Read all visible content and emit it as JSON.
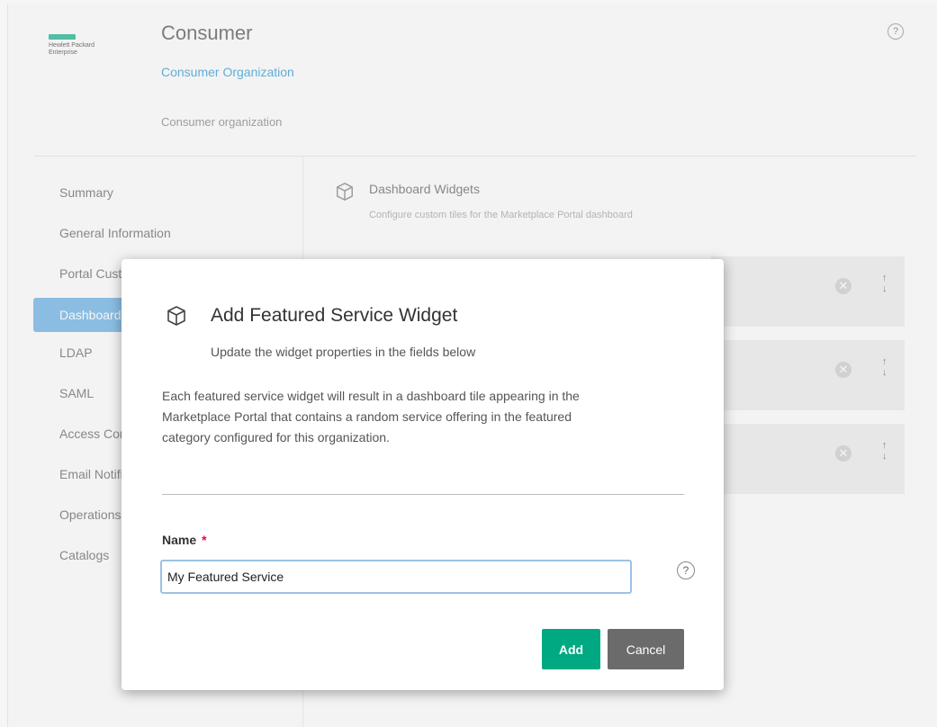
{
  "header": {
    "logo_lines": "Hewlett Packard\nEnterprise",
    "title": "Consumer",
    "org_link": "Consumer Organization",
    "subtitle": "Consumer organization",
    "help_symbol": "?"
  },
  "sidebar": {
    "items": [
      {
        "label": "Summary"
      },
      {
        "label": "General Information"
      },
      {
        "label": "Portal Customization"
      },
      {
        "label": "Dashboard Widgets",
        "active": true
      },
      {
        "label": "LDAP"
      },
      {
        "label": "SAML"
      },
      {
        "label": "Access Control"
      },
      {
        "label": "Email Notifications"
      },
      {
        "label": "Operations"
      },
      {
        "label": "Catalogs"
      }
    ]
  },
  "section": {
    "icon": "cube-icon",
    "title": "Dashboard Widgets",
    "subtitle": "Configure custom tiles for the Marketplace Portal dashboard",
    "rows": [
      {
        "remove_icon": "✕",
        "arrows": "↑\n↓"
      },
      {
        "remove_icon": "✕",
        "arrows": "↑\n↓"
      },
      {
        "remove_icon": "✕",
        "arrows": "↑\n↓"
      }
    ]
  },
  "modal": {
    "icon": "cube-icon",
    "title": "Add Featured Service Widget",
    "subtitle": "Update the widget properties in the fields below",
    "description": "Each featured service widget will result in a dashboard tile appearing in the Marketplace Portal that contains a random service offering in the featured category configured for this organization.",
    "name_label": "Name",
    "required_mark": "*",
    "name_value": "My Featured Service",
    "help_symbol": "?",
    "add_label": "Add",
    "cancel_label": "Cancel"
  },
  "colors": {
    "accent": "#01a982",
    "active_nav": "#5ba8e0",
    "link": "#1a8fd1",
    "cancel": "#6b6b6b",
    "required": "#e5004c"
  }
}
